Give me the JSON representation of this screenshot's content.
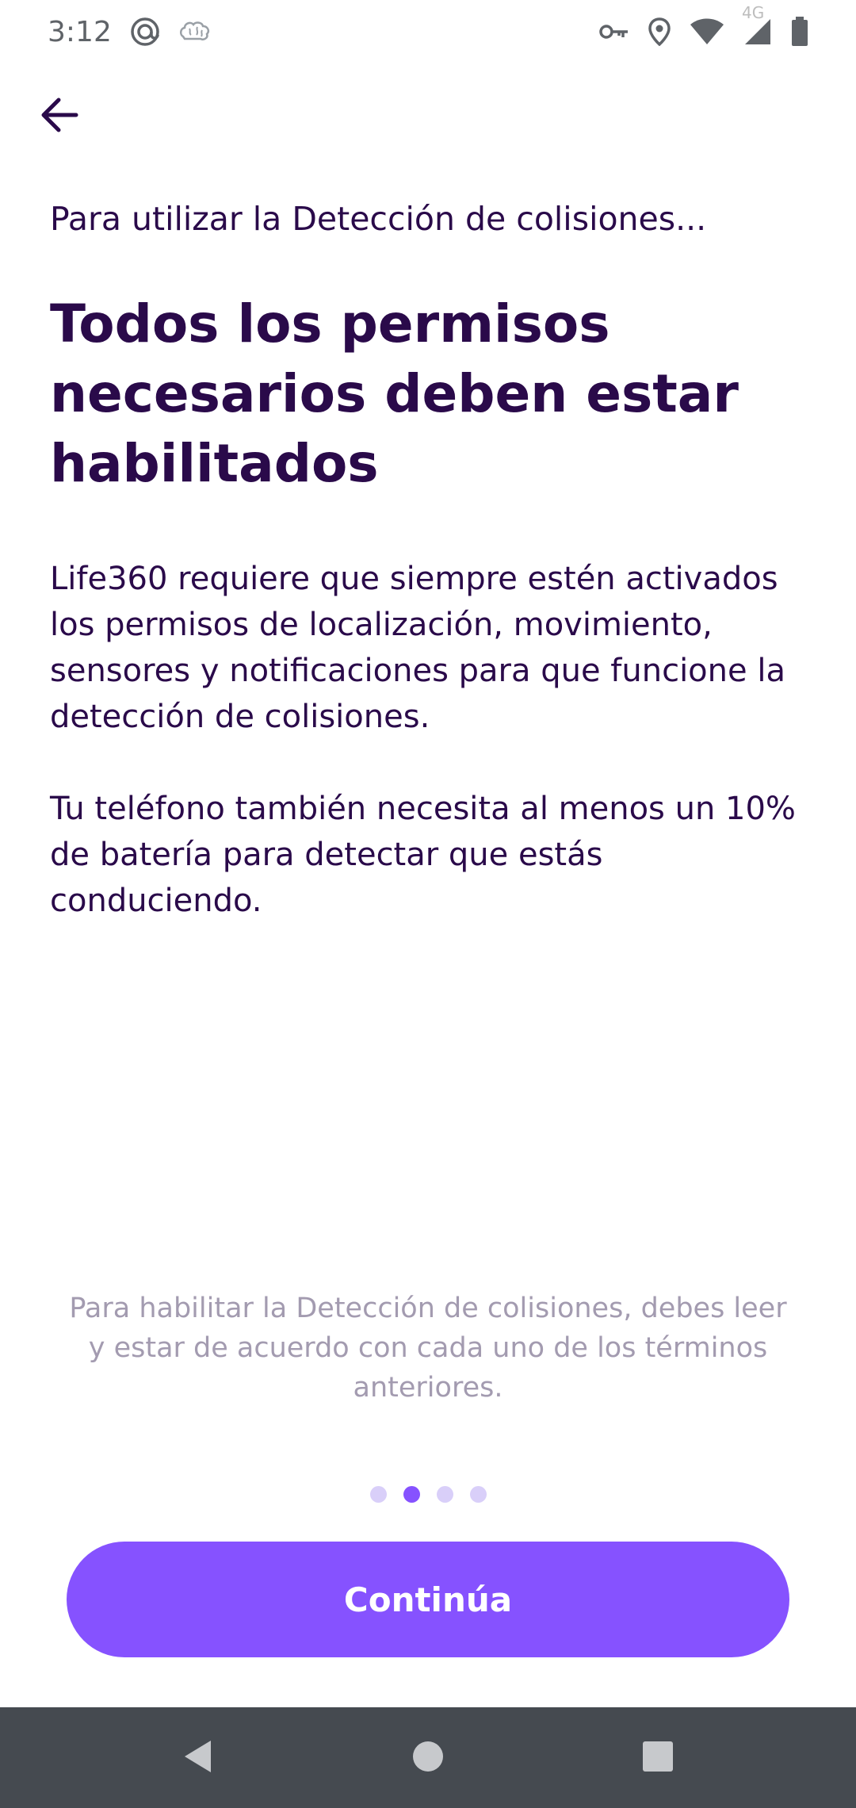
{
  "status_bar": {
    "time": "3:12",
    "network_label": "4G",
    "icons": [
      "at-sign-icon",
      "brain-icon",
      "vpn-key-icon",
      "location-pin-icon",
      "wifi-icon",
      "cell-signal-icon",
      "battery-icon"
    ]
  },
  "header": {
    "back_icon": "arrow-left-icon"
  },
  "main": {
    "subtitle": "Para utilizar la Detección de colisiones...",
    "headline": "Todos los permisos necesarios deben estar habilitados",
    "paragraph1": "Life360 requiere que siempre estén activados los permisos de localización, movimiento, sensores y notificaciones para que funcione la detección de colisiones.",
    "paragraph2": "Tu teléfono también necesita al menos un 10% de batería para detectar que estás conduciendo.",
    "footnote": "Para habilitar la Detección de colisiones, debes leer y estar de acuerdo con cada uno de los términos anteriores."
  },
  "pager": {
    "total": 4,
    "active_index": 1
  },
  "cta": {
    "label": "Continúa"
  },
  "nav_bar": {
    "icons": [
      "back-triangle-icon",
      "home-circle-icon",
      "recents-square-icon"
    ]
  },
  "colors": {
    "text": "#2a0a4a",
    "accent": "#8652ff",
    "dot_inactive": "#d9cff9",
    "footnote": "#a39bb0",
    "nav_bar": "#454a50"
  }
}
